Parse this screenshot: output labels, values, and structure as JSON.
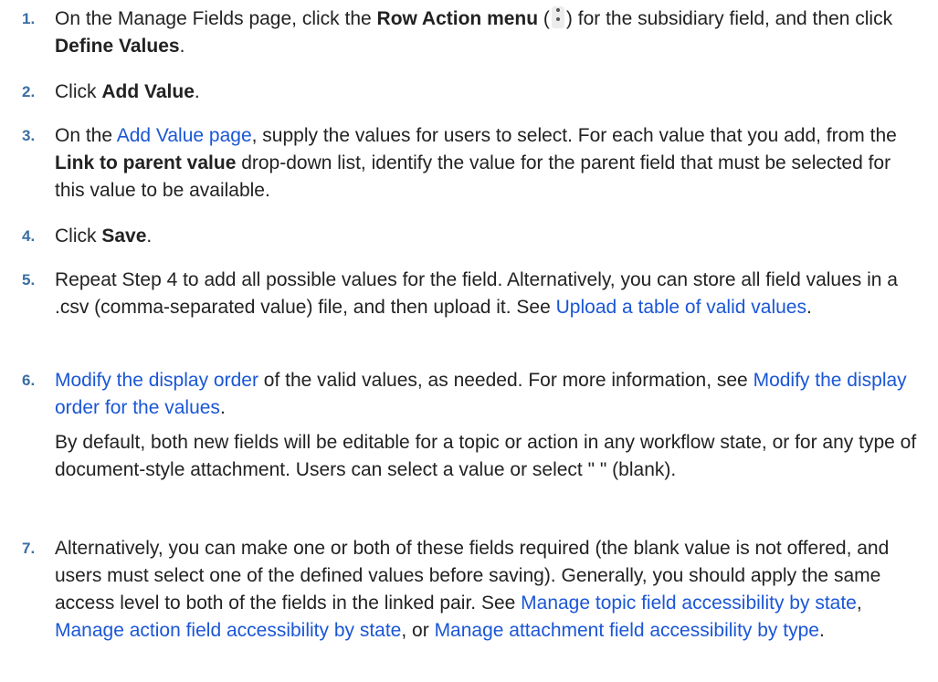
{
  "steps": [
    {
      "num": "1.",
      "t1": "On the Manage Fields page, click the ",
      "b1": "Row Action menu",
      "t2": " (",
      "t3": ") for the subsidiary field, and then click ",
      "b2": "Define Values",
      "t4": ".",
      "icon": "kebab-menu-icon"
    },
    {
      "num": "2.",
      "t1": "Click ",
      "b1": "Add Value",
      "t2": "."
    },
    {
      "num": "3.",
      "t1": "On the ",
      "link1": "Add Value page",
      "t2": ", supply the values for users to select. For each value that you add, from the ",
      "b1": "Link to parent value",
      "t3": " drop-down list, identify the value for the parent field that must be selected for this value to be available."
    },
    {
      "num": "4.",
      "t1": "Click ",
      "b1": "Save",
      "t2": "."
    },
    {
      "num": "5.",
      "t1": "Repeat Step 4 to add all possible values for the field. Alternatively, you can store all field values in a .csv (comma-separated value) file, and then upload it. See ",
      "link1": "Upload a table of valid values",
      "t2": "."
    },
    {
      "num": "6.",
      "link1": "Modify the display order",
      "t1": " of the valid values, as needed. For more information, see ",
      "link2": "Modify the display order for the values",
      "t2": ".",
      "note": "By default, both new fields will be editable for a topic or action in any workflow state, or for any type of document-style attachment. Users can select a value or select \" \" (blank)."
    },
    {
      "num": "7.",
      "t1": "Alternatively, you can make one or both of these fields required (the blank value is not offered, and users must select one of the defined values before saving). Generally, you should apply the same access level to both of the fields in the linked pair. See ",
      "link1": "Manage topic field accessibility by state",
      "t2": ", ",
      "link2": "Manage action field accessibility by state",
      "t3": ", or ",
      "link3": "Manage attachment field accessibility by type",
      "t4": "."
    }
  ],
  "colors": {
    "text": "#222222",
    "step_number": "#3a6ea5",
    "link": "#1a56d6"
  }
}
